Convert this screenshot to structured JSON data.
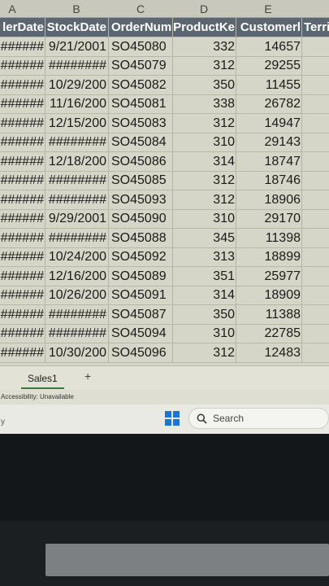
{
  "spreadsheet": {
    "column_letters": [
      "A",
      "B",
      "C",
      "D",
      "E"
    ],
    "headers": [
      "lerDate",
      "StockDate",
      "OrderNum",
      "ProductKe",
      "Customerl",
      "Terri"
    ],
    "rows": [
      [
        "######",
        "9/21/2001",
        "SO45080",
        "332",
        "14657"
      ],
      [
        "######",
        "########",
        "SO45079",
        "312",
        "29255"
      ],
      [
        "######",
        "10/29/200",
        "SO45082",
        "350",
        "11455"
      ],
      [
        "######",
        "11/16/200",
        "SO45081",
        "338",
        "26782"
      ],
      [
        "######",
        "12/15/200",
        "SO45083",
        "312",
        "14947"
      ],
      [
        "######",
        "########",
        "SO45084",
        "310",
        "29143"
      ],
      [
        "######",
        "12/18/200",
        "SO45086",
        "314",
        "18747"
      ],
      [
        "######",
        "########",
        "SO45085",
        "312",
        "18746"
      ],
      [
        "######",
        "########",
        "SO45093",
        "312",
        "18906"
      ],
      [
        "######",
        "9/29/2001",
        "SO45090",
        "310",
        "29170"
      ],
      [
        "######",
        "########",
        "SO45088",
        "345",
        "11398"
      ],
      [
        "######",
        "10/24/200",
        "SO45092",
        "313",
        "18899"
      ],
      [
        "######",
        "12/16/200",
        "SO45089",
        "351",
        "25977"
      ],
      [
        "######",
        "10/26/200",
        "SO45091",
        "314",
        "18909"
      ],
      [
        "######",
        "########",
        "SO45087",
        "350",
        "11388"
      ],
      [
        "######",
        "########",
        "SO45094",
        "310",
        "22785"
      ],
      [
        "######",
        "10/30/200",
        "SO45096",
        "312",
        "12483"
      ]
    ]
  },
  "sheet_tabs": {
    "active": "Sales1",
    "add_label": "+"
  },
  "status_bar": {
    "accessibility": "Accessibility: Unavailable"
  },
  "taskbar": {
    "search_label": "Search",
    "partial_text": "y"
  },
  "colors": {
    "header_bg": "#5b6670",
    "cell_bg": "#d6d6c8",
    "windows_blue": "#1976d6",
    "tab_accent": "#3c7a3c"
  }
}
